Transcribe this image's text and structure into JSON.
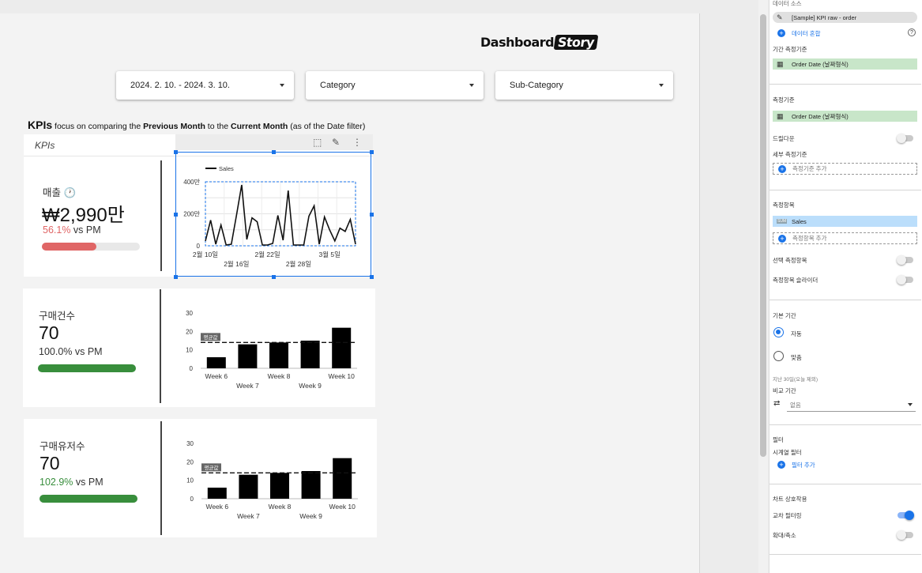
{
  "canvas": {
    "logo_main": "Dashboard",
    "logo_accent": "Story",
    "filters": [
      {
        "label": "2024. 2. 10. - 2024. 3. 10."
      },
      {
        "label": "Category"
      },
      {
        "label": "Sub-Category"
      }
    ],
    "heading": {
      "kpis": "KPIs",
      "t1": " focus on comparing the ",
      "prev": "Previous Month",
      "t2": " to the ",
      "curr": "Current Month",
      "t3": " (as of the Date filter)"
    },
    "card_title": "KPIs",
    "kpi_cards": [
      {
        "name": "매출",
        "value": "₩2,990만",
        "delta_pct": "56.1%",
        "delta_suffix": " vs PM",
        "delta_color": "#e06666",
        "bar_color": "#e06666",
        "progress": 0.56
      },
      {
        "name": "구매건수",
        "value": "70",
        "delta_pct": "100.0% vs PM",
        "delta_suffix": "",
        "delta_color": "#333333",
        "bar_color": "#388e3c",
        "progress": 1.0
      },
      {
        "name": "구매유저수",
        "value": "70",
        "delta_pct": "102.9%",
        "delta_suffix": " vs PM",
        "delta_color": "#388e3c",
        "bar_color": "#388e3c",
        "progress": 1.0
      }
    ]
  },
  "chart_data": [
    {
      "type": "line",
      "legend": "Sales",
      "y_ticks": [
        "0",
        "200만",
        "400만"
      ],
      "ylim": [
        0,
        400
      ],
      "x_ticks_top": [
        "2월 10일",
        "2월 22일",
        "3월 5일"
      ],
      "x_ticks_bottom": [
        "2월 16일",
        "2월 28일"
      ],
      "x_tick_top_days": [
        0,
        12,
        24
      ],
      "x_tick_bottom_days": [
        6,
        18
      ],
      "n_days": 30,
      "values": [
        30,
        160,
        10,
        130,
        5,
        10,
        190,
        380,
        40,
        175,
        150,
        5,
        5,
        15,
        190,
        35,
        345,
        5,
        5,
        5,
        185,
        250,
        10,
        180,
        100,
        30,
        110,
        90,
        165,
        10
      ]
    },
    {
      "type": "bar",
      "categories": [
        "Week 6",
        "Week 7",
        "Week 8",
        "Week 9",
        "Week 10"
      ],
      "values": [
        6,
        13,
        14,
        15,
        22
      ],
      "average": 14,
      "average_label": "평균값",
      "y_ticks": [
        "0",
        "10",
        "20",
        "30"
      ],
      "ylim": [
        0,
        30
      ]
    },
    {
      "type": "bar",
      "categories": [
        "Week 6",
        "Week 7",
        "Week 8",
        "Week 9",
        "Week 10"
      ],
      "values": [
        6,
        13,
        14,
        15,
        22
      ],
      "average": 14,
      "average_label": "평균값",
      "y_ticks": [
        "0",
        "10",
        "20",
        "30"
      ],
      "ylim": [
        0,
        30
      ]
    }
  ],
  "panel": {
    "data_source_title": "데이터 소스",
    "data_source": "[Sample] KPI raw - order",
    "blend_link": "데이터 혼합",
    "date_range_dimension_label": "기간 측정기준",
    "date_range_dimension": "Order Date (날짜형식)",
    "dimension_label": "측정기준",
    "dimension": "Order Date (날짜형식)",
    "drilldown_label": "드릴다운",
    "breakdown_label": "세부 측정기준",
    "add_dimension": "측정기준 추가",
    "metric_label": "측정항목",
    "metric_badge": "SUM",
    "metric": "Sales",
    "add_metric": "측정항목 추가",
    "optional_metric_label": "선택 측정항목",
    "metric_slider_label": "측정항목 슬라이더",
    "default_range_label": "기본 기간",
    "auto_option": "자동",
    "custom_option": "맞춤",
    "last_30_days": "지난 30일(오늘 제외)",
    "compare_label": "비교 기간",
    "compare_value": "없음",
    "filter_label": "필터",
    "series_filter_label": "시계열 필터",
    "add_filter": "필터 추가",
    "interaction_label": "차트 상호작용",
    "cross_filter_label": "교차 필터링",
    "zoom_label": "확대/축소",
    "colors": {
      "accent": "#1a73e8",
      "dimension_chip": "#c8e6c9",
      "metric_chip": "#bbdefb"
    }
  }
}
